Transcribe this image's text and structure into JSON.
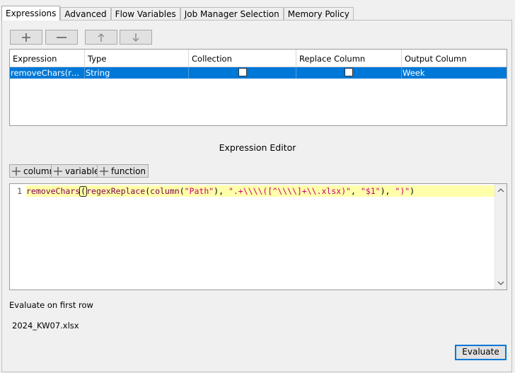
{
  "tabs": [
    {
      "label": "Expressions",
      "active": true
    },
    {
      "label": "Advanced"
    },
    {
      "label": "Flow Variables"
    },
    {
      "label": "Job Manager Selection"
    },
    {
      "label": "Memory Policy"
    }
  ],
  "toolbar": {
    "add": "plus-icon",
    "remove": "minus-icon",
    "move_up": "arrow-up-icon",
    "move_down": "arrow-down-icon"
  },
  "table": {
    "headers": [
      "Expression",
      "Type",
      "Collection",
      "Replace Column",
      "Output Column"
    ],
    "rows": [
      {
        "expression": "removeChars(rege...",
        "type": "String",
        "collection": false,
        "replace_column": false,
        "output_column": "Week",
        "selected": true
      }
    ]
  },
  "editor": {
    "title": "Expression Editor",
    "insert_buttons": [
      "column",
      "variable",
      "function"
    ],
    "line_number": "1",
    "code": {
      "t1": "removeChars",
      "t2": "(",
      "t3": "regexReplace",
      "t4": "(",
      "t5": "column",
      "t6": "(",
      "t7": "\"Path\"",
      "t8": "), ",
      "t9": "\".+\\\\\\\\([^\\\\\\\\]+\\\\.xlsx)\"",
      "t10": ", ",
      "t11": "\"$1\"",
      "t12": "), ",
      "t13": "\")\"",
      "t14": ")"
    }
  },
  "evaluation": {
    "label": "Evaluate on first row",
    "result": "2024_KW07.xlsx",
    "button": "Evaluate"
  },
  "colors": {
    "selection": "#0078d7",
    "keyword": "#7f0055",
    "string": "#c8007a",
    "current_line": "#ffffaa"
  }
}
